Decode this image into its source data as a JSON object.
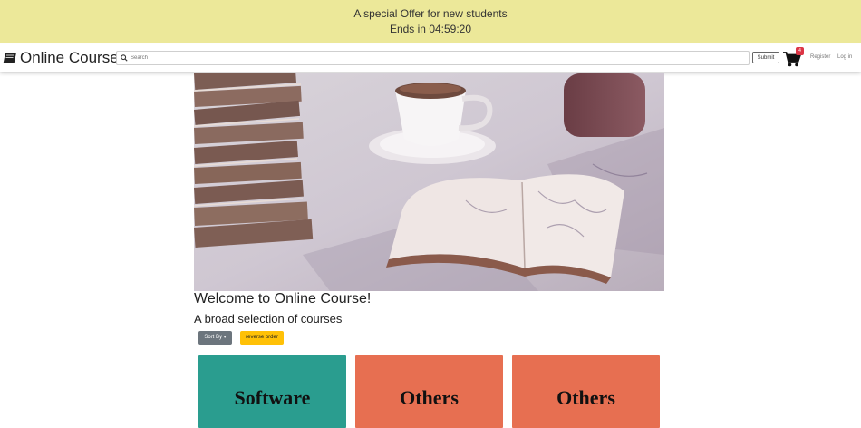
{
  "promo": {
    "line1": "A special Offer for new students",
    "line2": "Ends in 04:59:20",
    "background": "#ece899"
  },
  "nav": {
    "brand": "Online Course",
    "brand_icon": "book-icon",
    "search_placeholder": "Search",
    "submit_label": "Submit",
    "cart_count": "4",
    "register_label": "Register",
    "login_label": "Log in"
  },
  "hero": {
    "title": "Welcome to Online Course!",
    "subtitle": "A broad selection of courses"
  },
  "controls": {
    "sort_label": "Sort By",
    "reverse_label": "reverse order"
  },
  "courses": [
    {
      "label": "Software",
      "color": "#2a9d8f"
    },
    {
      "label": "Others",
      "color": "#e76f51"
    },
    {
      "label": "Others",
      "color": "#e76f51"
    }
  ]
}
